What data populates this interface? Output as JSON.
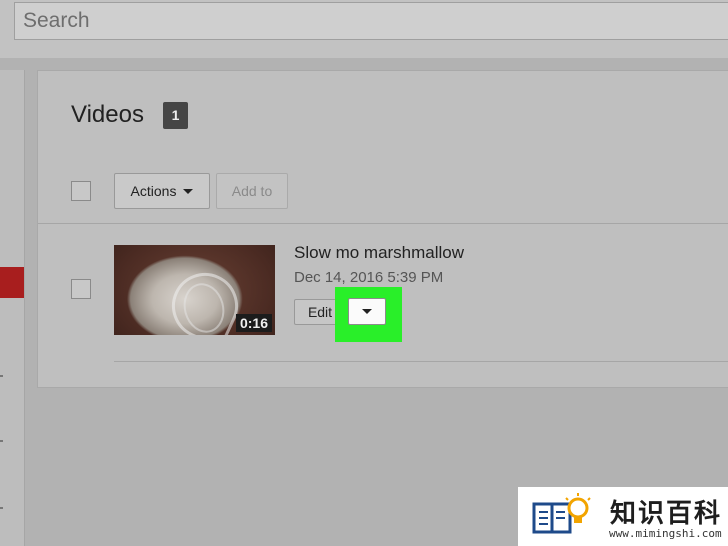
{
  "search": {
    "placeholder": "Search"
  },
  "videos": {
    "title": "Videos",
    "count": "1",
    "toolbar": {
      "actions_label": "Actions",
      "add_to_label": "Add to"
    },
    "items": [
      {
        "title": "Slow mo marshmallow",
        "date": "Dec 14, 2016 5:39 PM",
        "duration": "0:16",
        "edit_label": "Edit"
      }
    ]
  },
  "colors": {
    "highlight": "#29ef29",
    "sidebar_active": "#a81e1e",
    "count_badge": "#454545"
  },
  "watermark": {
    "name": "知识百科",
    "url": "www.mimingshi.com"
  }
}
